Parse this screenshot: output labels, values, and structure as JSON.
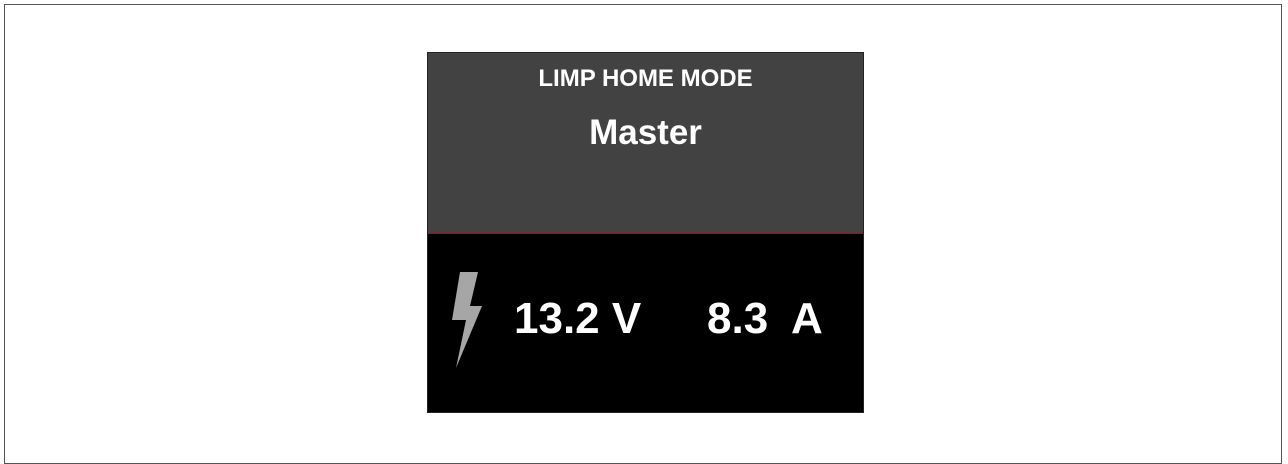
{
  "display": {
    "mode_title": "LIMP HOME MODE",
    "role_label": "Master",
    "voltage_text": "13.2 V",
    "current_text": "8.3  A",
    "bolt_icon": "lightning-bolt-icon"
  },
  "colors": {
    "header_background": "#424242",
    "value_background": "#000000",
    "text": "#ffffff",
    "bolt": "#a6a6a6",
    "divider": "#8a1a1a"
  }
}
